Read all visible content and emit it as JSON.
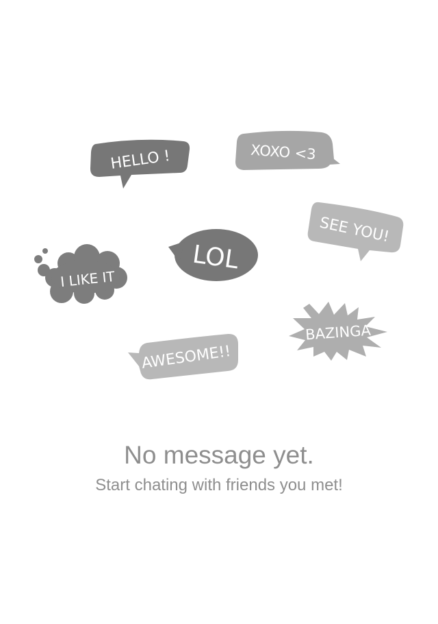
{
  "colors": {
    "dark_bubble": "#777777",
    "light_bubble": "#b5b5b5",
    "bubble_text": "#ffffff",
    "message_text": "#8e8e8e",
    "background": "#ffffff"
  },
  "bubbles": {
    "hello": "HELLO !",
    "xoxo": "XOXO <3",
    "see_you": "SEE YOU!",
    "lol": "LOL",
    "i_like_it": "I LIKE IT",
    "bazinga": "BAZINGA",
    "awesome": "AWESOME!!"
  },
  "empty_state": {
    "title": "No message yet.",
    "subtitle": "Start chating with friends you met!"
  }
}
